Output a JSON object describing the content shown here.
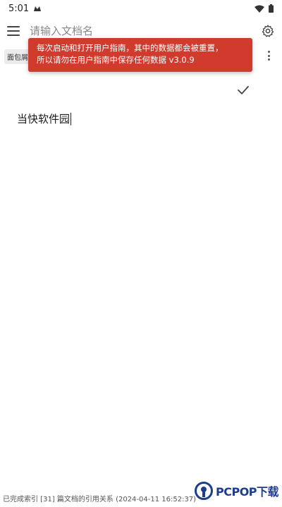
{
  "status_bar": {
    "time": "5:01"
  },
  "toolbar": {
    "search_placeholder": "请输入文档名"
  },
  "tabs": [
    {
      "label": "面包屑"
    }
  ],
  "toast": {
    "line1": "每次启动和打开用户指南，其中的数据都会被重置，",
    "line2": "所以请勿在用户指南中保存任何数据 v3.0.9"
  },
  "editor": {
    "content": "当快软件园"
  },
  "footer": {
    "status": "已完成索引 [31] 篇文档的引用关系 (2024-04-11 16:52:37)"
  },
  "watermark": {
    "text": "PCPOP下载"
  },
  "colors": {
    "toast_bg": "#d13b2e",
    "watermark": "#1d3d8f"
  }
}
